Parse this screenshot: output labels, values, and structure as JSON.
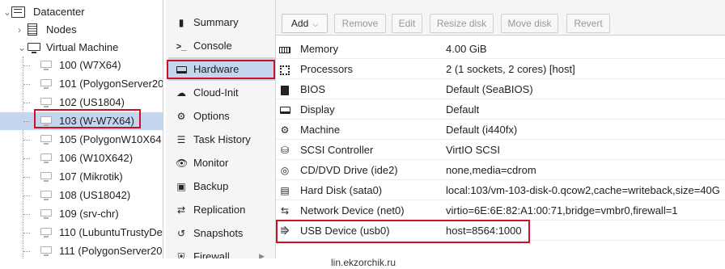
{
  "tree": {
    "datacenter_label": "Datacenter",
    "nodes_label": "Nodes",
    "vm_group_label": "Virtual Machine",
    "vms": [
      {
        "label": "100 (W7X64)"
      },
      {
        "label": "101 (PolygonServer20"
      },
      {
        "label": "102 (US1804)"
      },
      {
        "label": "103 (W-W7X64)",
        "selected": true
      },
      {
        "label": "105 (PolygonW10X64"
      },
      {
        "label": "106 (W10X642)"
      },
      {
        "label": "107 (Mikrotik)"
      },
      {
        "label": "108 (US18042)"
      },
      {
        "label": "109 (srv-chr)"
      },
      {
        "label": "110 (LubuntuTrustyDe"
      },
      {
        "label": "111 (PolygonServer20"
      }
    ]
  },
  "nav": {
    "items": [
      {
        "label": "Summary",
        "icon": "book-icon"
      },
      {
        "label": "Console",
        "icon": "terminal-icon"
      },
      {
        "label": "Hardware",
        "icon": "desktop-icon",
        "active": true
      },
      {
        "label": "Cloud-Init",
        "icon": "cloud-icon"
      },
      {
        "label": "Options",
        "icon": "gear-icon"
      },
      {
        "label": "Task History",
        "icon": "list-icon"
      },
      {
        "label": "Monitor",
        "icon": "eye-icon"
      },
      {
        "label": "Backup",
        "icon": "floppy-icon"
      },
      {
        "label": "Replication",
        "icon": "retweet-icon"
      },
      {
        "label": "Snapshots",
        "icon": "history-icon"
      },
      {
        "label": "Firewall",
        "icon": "shield-icon"
      }
    ]
  },
  "toolbar": {
    "add": "Add",
    "remove": "Remove",
    "edit": "Edit",
    "resize": "Resize disk",
    "move": "Move disk",
    "revert": "Revert"
  },
  "hardware": [
    {
      "name": "Memory",
      "value": "4.00 GiB",
      "icon": "memory-icon"
    },
    {
      "name": "Processors",
      "value": "2 (1 sockets, 2 cores) [host]",
      "icon": "cpu-icon"
    },
    {
      "name": "BIOS",
      "value": "Default (SeaBIOS)",
      "icon": "microchip-icon"
    },
    {
      "name": "Display",
      "value": "Default",
      "icon": "desktop-icon"
    },
    {
      "name": "Machine",
      "value": "Default (i440fx)",
      "icon": "cogs-icon"
    },
    {
      "name": "SCSI Controller",
      "value": "VirtIO SCSI",
      "icon": "database-icon"
    },
    {
      "name": "CD/DVD Drive (ide2)",
      "value": "none,media=cdrom",
      "icon": "cdrom-icon"
    },
    {
      "name": "Hard Disk (sata0)",
      "value": "local:103/vm-103-disk-0.qcow2,cache=writeback,size=40G",
      "icon": "hdd-icon"
    },
    {
      "name": "Network Device (net0)",
      "value": "virtio=6E:6E:82:A1:00:71,bridge=vmbr0,firewall=1",
      "icon": "exchange-icon"
    },
    {
      "name": "USB Device (usb0)",
      "value": "host=8564:1000",
      "icon": "usb-icon"
    }
  ],
  "watermark": "lin.ekzorchik.ru",
  "colors": {
    "selection": "#c3d6ee",
    "highlight": "#d10f22"
  }
}
